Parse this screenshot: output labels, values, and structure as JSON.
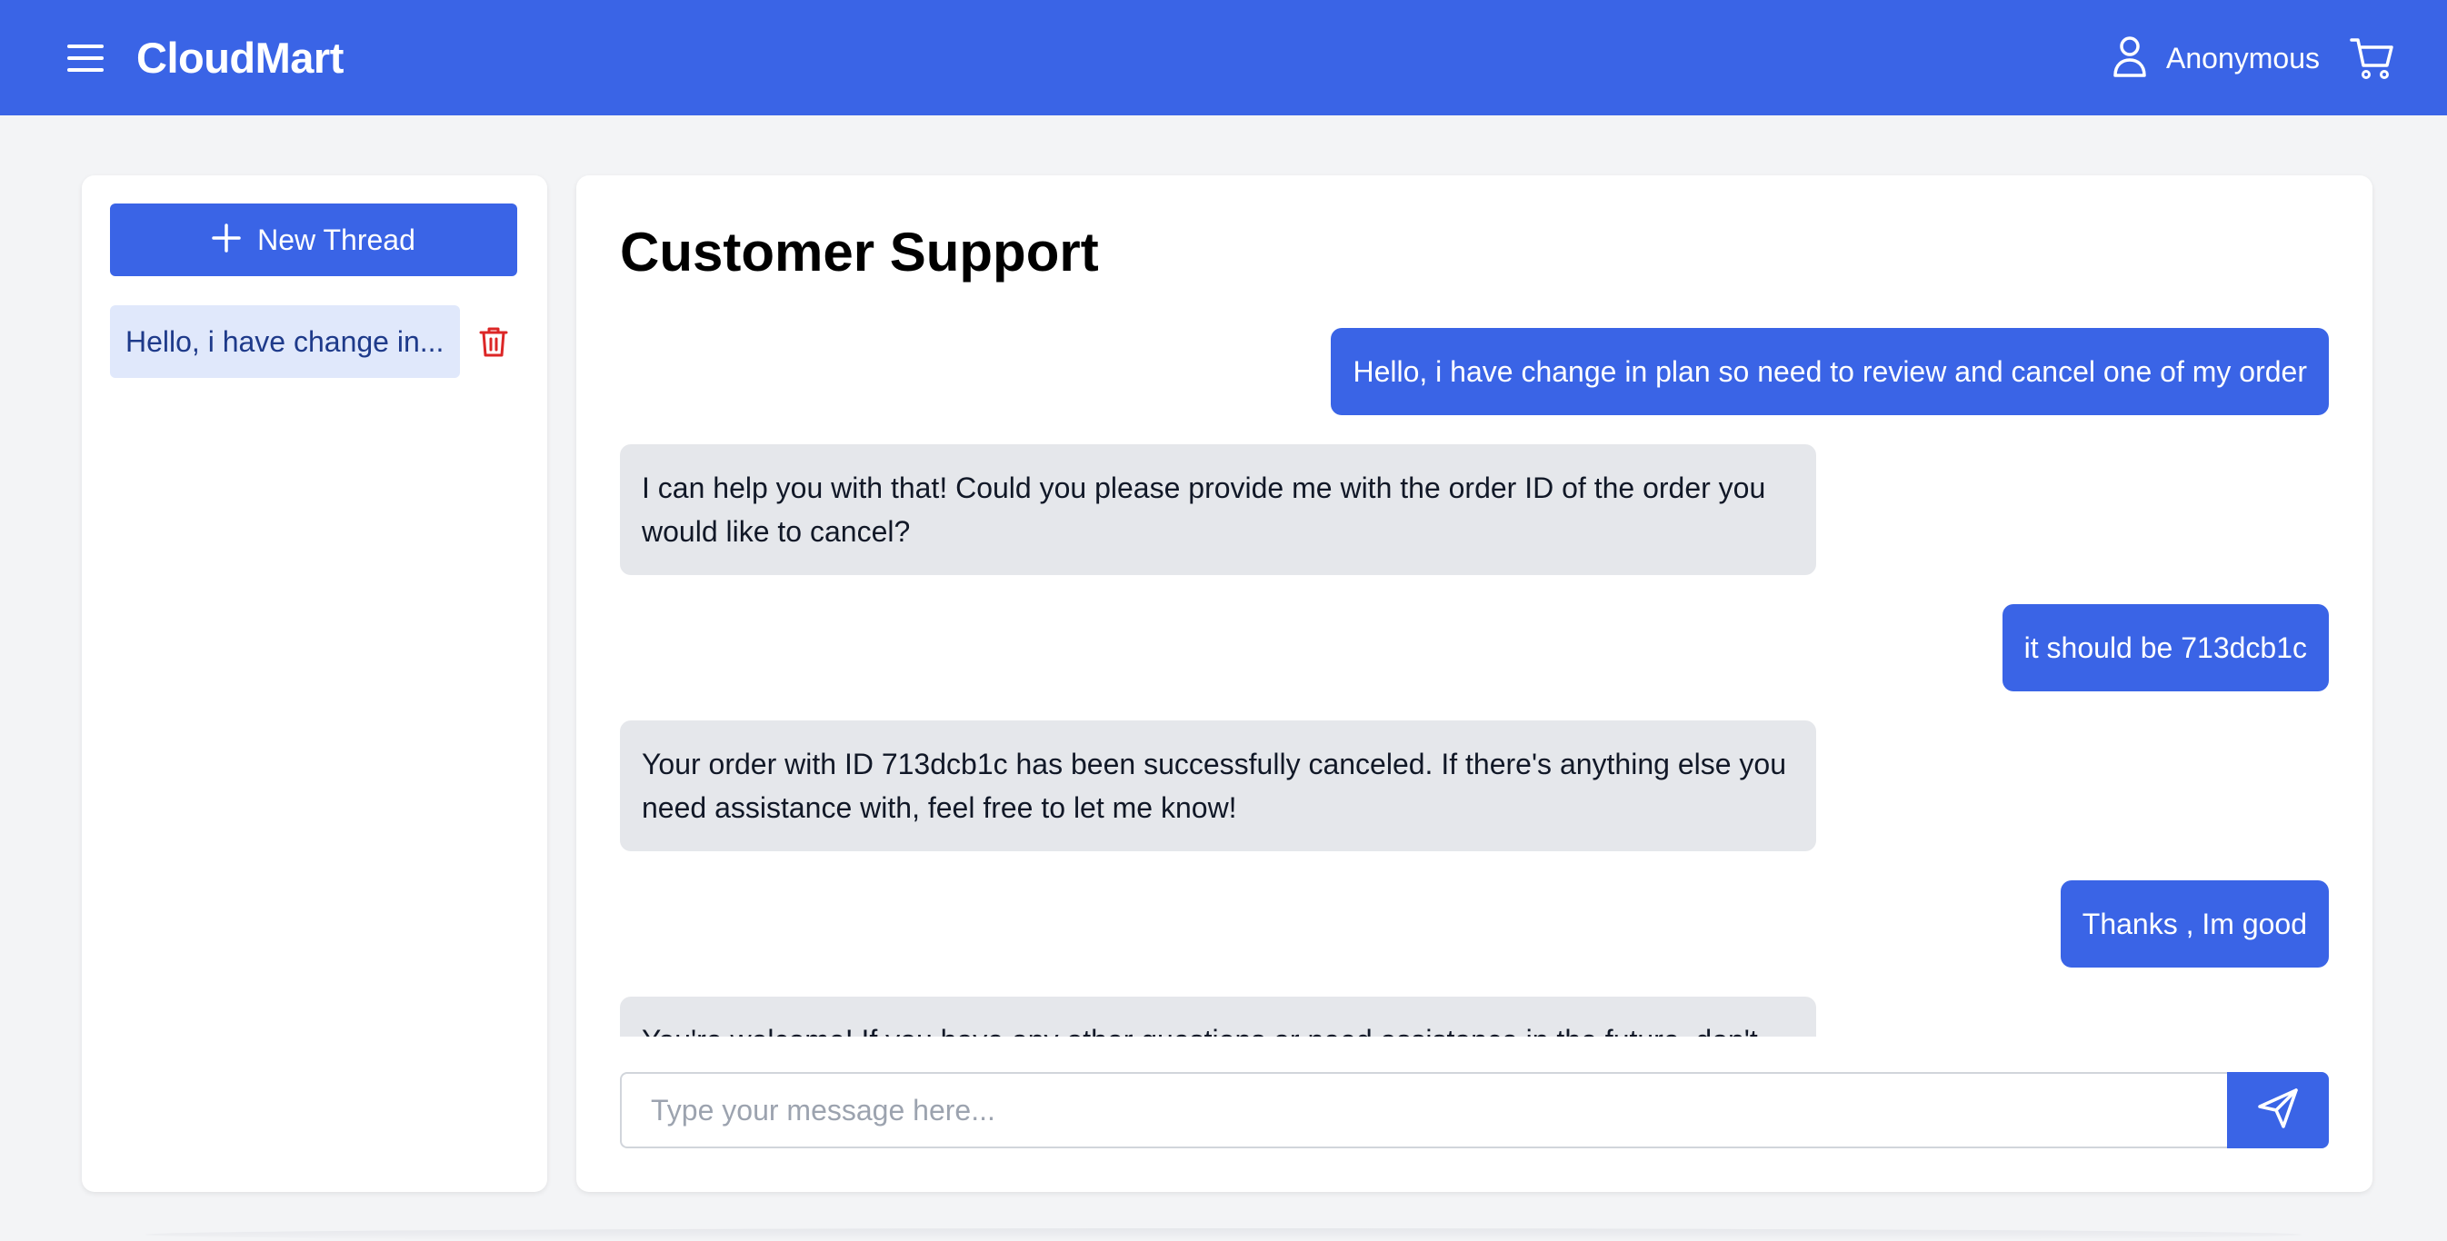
{
  "app": {
    "brand": "CloudMart",
    "accent_color": "#3a64e6",
    "background_color": "#f3f4f6"
  },
  "header": {
    "menu_icon": "hamburger-menu-icon",
    "user_icon": "user-icon",
    "user_label": "Anonymous",
    "cart_icon": "shopping-cart-icon"
  },
  "sidebar": {
    "new_thread_label": "New Thread",
    "new_thread_icon": "plus-icon",
    "threads": [
      {
        "title": "Hello, i have change in...",
        "delete_icon": "trash-icon"
      }
    ]
  },
  "chat": {
    "title": "Customer Support",
    "messages": [
      {
        "role": "user",
        "text": "Hello, i have change in plan so need to review and cancel one of my order"
      },
      {
        "role": "assistant",
        "text": "I can help you with that! Could you please provide me with the order ID of the order you would like to cancel?"
      },
      {
        "role": "user",
        "text": "it should be 713dcb1c"
      },
      {
        "role": "assistant",
        "text": "Your order with ID 713dcb1c has been successfully canceled. If there's anything else you need assistance with, feel free to let me know!"
      },
      {
        "role": "user",
        "text": "Thanks , Im good"
      },
      {
        "role": "assistant",
        "text": "You're welcome! If you have any other questions or need assistance in the future, don't"
      }
    ],
    "input_placeholder": "Type your message here...",
    "input_value": "",
    "send_icon": "send-icon"
  }
}
